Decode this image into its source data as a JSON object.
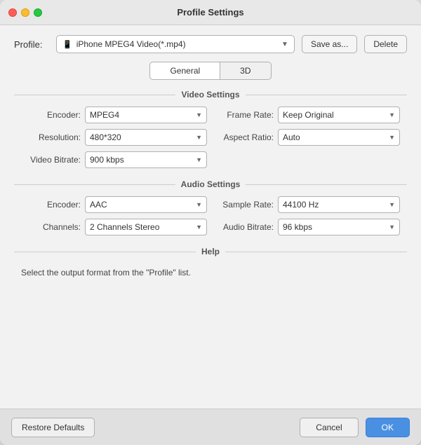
{
  "window": {
    "title": "Profile Settings"
  },
  "profile": {
    "label": "Profile:",
    "value": "iPhone MPEG4 Video(*.mp4)",
    "icon": "📱",
    "save_as_label": "Save as...",
    "delete_label": "Delete"
  },
  "tabs": [
    {
      "id": "general",
      "label": "General",
      "active": true
    },
    {
      "id": "3d",
      "label": "3D",
      "active": false
    }
  ],
  "video_settings": {
    "title": "Video Settings",
    "fields": [
      {
        "label": "Encoder:",
        "value": "MPEG4"
      },
      {
        "label": "Frame Rate:",
        "value": "Keep Original"
      },
      {
        "label": "Resolution:",
        "value": "480*320"
      },
      {
        "label": "Aspect Ratio:",
        "value": "Auto"
      },
      {
        "label": "Video Bitrate:",
        "value": "900 kbps"
      }
    ]
  },
  "audio_settings": {
    "title": "Audio Settings",
    "fields": [
      {
        "label": "Encoder:",
        "value": "AAC"
      },
      {
        "label": "Sample Rate:",
        "value": "44100 Hz"
      },
      {
        "label": "Channels:",
        "value": "2 Channels Stereo"
      },
      {
        "label": "Audio Bitrate:",
        "value": "96 kbps"
      }
    ]
  },
  "help": {
    "title": "Help",
    "text": "Select the output format from the \"Profile\" list."
  },
  "footer": {
    "restore_label": "Restore Defaults",
    "cancel_label": "Cancel",
    "ok_label": "OK"
  }
}
